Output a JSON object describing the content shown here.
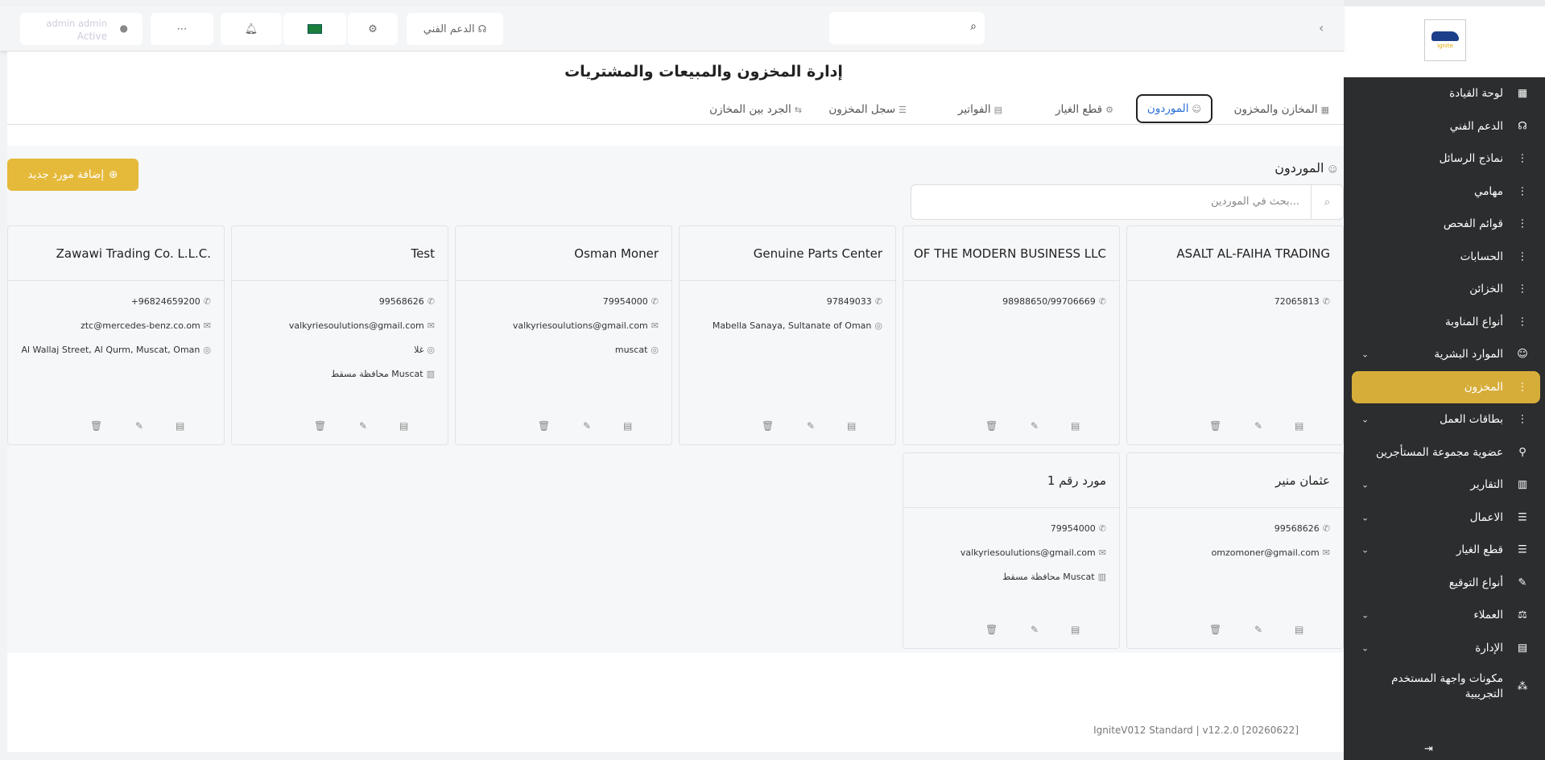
{
  "topbar": {
    "search_placeholder": "",
    "support_label": "الدعم الفني",
    "user_name": "admin admin",
    "user_status": "Active"
  },
  "sidebar": {
    "items": [
      {
        "label": "لوحة القيادة",
        "icon": "dashboard-icon",
        "glyph": "▦"
      },
      {
        "label": "الدعم الفني",
        "icon": "headset-icon",
        "glyph": "☊"
      },
      {
        "label": "نماذج الرسائل",
        "icon": "more-vertical-icon",
        "glyph": "⋮"
      },
      {
        "label": "مهامي",
        "icon": "more-vertical-icon",
        "glyph": "⋮"
      },
      {
        "label": "قوائم الفحص",
        "icon": "more-vertical-icon",
        "glyph": "⋮"
      },
      {
        "label": "الحسابات",
        "icon": "more-vertical-icon",
        "glyph": "⋮"
      },
      {
        "label": "الخزائن",
        "icon": "more-vertical-icon",
        "glyph": "⋮"
      },
      {
        "label": "أنواع المناوبة",
        "icon": "more-vertical-icon",
        "glyph": "⋮"
      },
      {
        "label": "الموارد البشرية",
        "icon": "users-icon",
        "glyph": "☺",
        "chevron": true
      },
      {
        "label": "المخزون",
        "icon": "more-vertical-icon",
        "glyph": "⋮",
        "active": true
      },
      {
        "label": "بطاقات العمل",
        "icon": "more-vertical-icon",
        "glyph": "⋮",
        "chevron": true
      },
      {
        "label": "عضوية مجموعة المستأجرين",
        "icon": "group-icon",
        "glyph": "⚲"
      },
      {
        "label": "التقارير",
        "icon": "chart-icon",
        "glyph": "▥",
        "chevron": true
      },
      {
        "label": "الاعمال",
        "icon": "sliders-icon",
        "glyph": "☰",
        "chevron": true
      },
      {
        "label": "قطع الغيار",
        "icon": "sliders-icon",
        "glyph": "☰",
        "chevron": true
      },
      {
        "label": "أنواع التوقيع",
        "icon": "pen-icon",
        "glyph": "✎"
      },
      {
        "label": "العملاء",
        "icon": "customers-icon",
        "glyph": "⚖",
        "chevron": true
      },
      {
        "label": "الإدارة",
        "icon": "admin-icon",
        "glyph": "▤",
        "chevron": true
      },
      {
        "label": "مكونات واجهة المستخدم التجريبية",
        "icon": "grid-icon",
        "glyph": "⁂",
        "two_line": true
      }
    ]
  },
  "page": {
    "title": "إدارة المخزون والمبيعات والمشتريات",
    "tabs": [
      {
        "label": "المخازن والمخزون",
        "icon": "warehouse-icon",
        "glyph": "▦"
      },
      {
        "label": "الموردون",
        "icon": "suppliers-icon",
        "glyph": "☺",
        "active": true
      },
      {
        "label": "قطع الغيار",
        "icon": "gear-icon",
        "glyph": "⚙"
      },
      {
        "label": "الفواتير",
        "icon": "invoice-icon",
        "glyph": "▤"
      },
      {
        "label": "سجل المخزون",
        "icon": "list-icon",
        "glyph": "☰"
      },
      {
        "label": "الجرد بين المخازن",
        "icon": "transfer-icon",
        "glyph": "⇆"
      }
    ],
    "section_title": "الموردون",
    "add_button": "إضافة مورد جديد",
    "search_placeholder": "بحث في الموردين..."
  },
  "suppliers": [
    {
      "name": "ASALT AL-FAIHA TRADING",
      "phone": "72065813"
    },
    {
      "name": "OF THE MODERN BUSINESS LLC",
      "phone": "98988650/99706669"
    },
    {
      "name": "Genuine Parts Center",
      "phone": "97849033",
      "address": "Mabella Sanaya, Sultanate of Oman"
    },
    {
      "name": "Osman Moner",
      "phone": "79954000",
      "email": "valkyriesoulutions@gmail.com",
      "address": "muscat"
    },
    {
      "name": "Test",
      "phone": "99568626",
      "email": "valkyriesoulutions@gmail.com",
      "address": "غلا",
      "region": "محافظة مسقط Muscat"
    },
    {
      "name": "Zawawi Trading Co. L.L.C.",
      "phone": "+96824659200",
      "email": "ztc@mercedes-benz.co.om",
      "address": "Al Wallaj Street, Al Qurm, Muscat, Oman"
    },
    {
      "name": "عثمان منير",
      "phone": "99568626",
      "email": "omzomoner@gmail.com"
    },
    {
      "name": "مورد رقم 1",
      "phone": "79954000",
      "email": "valkyriesoulutions@gmail.com",
      "region": "محافظة مسقط Muscat"
    }
  ],
  "footer": {
    "version": "IgniteV012 Standard | v12.2.0 [20260622]"
  },
  "colors": {
    "accent": "#e5b93a",
    "sidebar_bg": "#2b2d2e",
    "active_tab": "#2a6fd6"
  }
}
